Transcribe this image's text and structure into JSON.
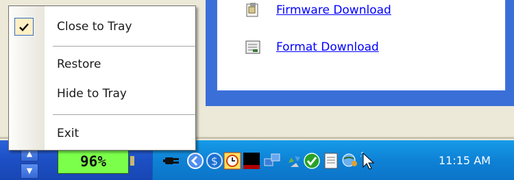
{
  "window": {
    "links": [
      {
        "label": "Firmware Download",
        "icon": "firmware-icon"
      },
      {
        "label": "Format Download",
        "icon": "format-icon"
      }
    ]
  },
  "menu": {
    "items": [
      {
        "label": "Close to Tray",
        "checked": true
      },
      {
        "label": "Restore",
        "checked": false
      },
      {
        "label": "Hide to Tray",
        "checked": false
      },
      {
        "label": "Exit",
        "checked": false
      }
    ]
  },
  "taskbar": {
    "battery_percent": "96%",
    "clock": "11:15 AM",
    "tray_icons": [
      "power-plug-icon",
      "collapse-arrow-icon",
      "currency-icon",
      "clock-app-icon",
      "monitor-app-icon",
      "network-icon",
      "recycle-icon",
      "shield-check-icon",
      "notepad-icon",
      "globe-search-icon",
      "cursor-icon"
    ]
  },
  "colors": {
    "taskbar": "#1c4fc4",
    "tray": "#0e82d6",
    "battery": "#7bff4a",
    "link": "#0000ff"
  }
}
